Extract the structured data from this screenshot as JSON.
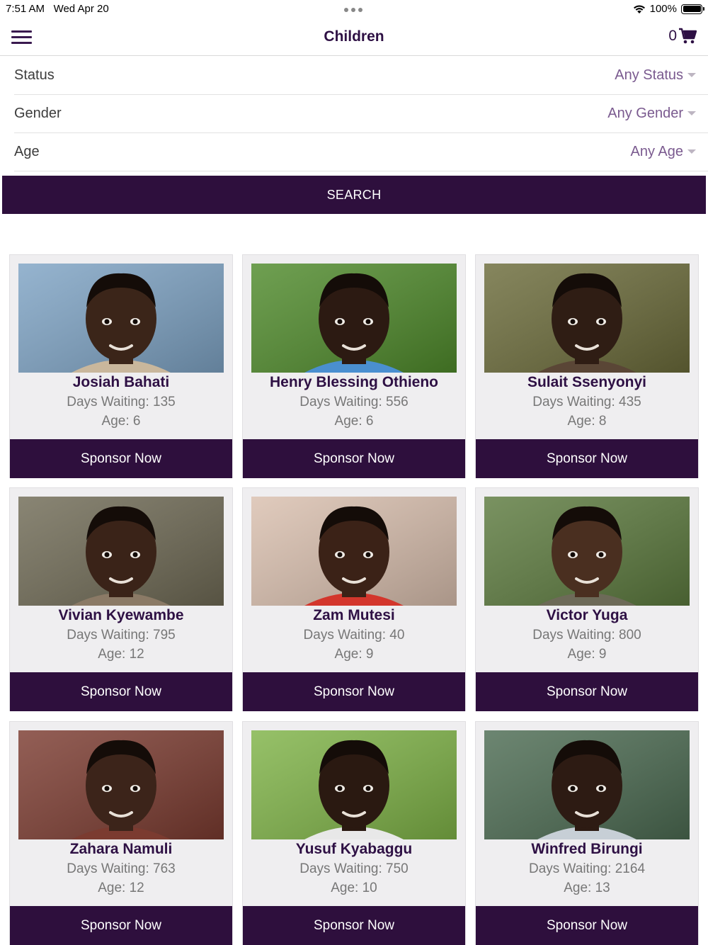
{
  "status_bar": {
    "time": "7:51 AM",
    "date": "Wed Apr 20",
    "battery": "100%"
  },
  "nav": {
    "title": "Children",
    "cart_count": "0"
  },
  "filters": [
    {
      "label": "Status",
      "value": "Any Status"
    },
    {
      "label": "Gender",
      "value": "Any Gender"
    },
    {
      "label": "Age",
      "value": "Any Age"
    }
  ],
  "search_label": "SEARCH",
  "sponsor_label": "Sponsor Now",
  "children": [
    {
      "name": "Josiah Bahati",
      "days": "Days Waiting: 135",
      "age": "Age: 6",
      "bg": "#7ea3c4",
      "skin": "#3b2519",
      "shirt": "#c9b79c"
    },
    {
      "name": "Henry Blessing Othieno",
      "days": "Days Waiting: 556",
      "age": "Age: 6",
      "bg": "#4f8a2b",
      "skin": "#2c1a12",
      "shirt": "#4a8fd0"
    },
    {
      "name": "Sulait Ssenyonyi",
      "days": "Days Waiting: 435",
      "age": "Age: 8",
      "bg": "#6b6b3a",
      "skin": "#2f1d14",
      "shirt": "#5a4636"
    },
    {
      "name": "Vivian Kyewambe",
      "days": "Days Waiting: 795",
      "age": "Age: 12",
      "bg": "#6f6a55",
      "skin": "#3a2318",
      "shirt": "#8b7a66"
    },
    {
      "name": "Zam Mutesi",
      "days": "Days Waiting: 40",
      "age": "Age: 9",
      "bg": "#d9bfae",
      "skin": "#3b2217",
      "shirt": "#d3362c"
    },
    {
      "name": "Victor Yuga",
      "days": "Days Waiting: 800",
      "age": "Age: 9",
      "bg": "#5c7a3e",
      "skin": "#4a2f20",
      "shirt": "#6d6a58"
    },
    {
      "name": "Zahara Namuli",
      "days": "Days Waiting: 763",
      "age": "Age: 12",
      "bg": "#7b3b30",
      "skin": "#3c241a",
      "shirt": "#7b3b30"
    },
    {
      "name": "Yusuf Kyabaggu",
      "days": "Days Waiting: 750",
      "age": "Age: 10",
      "bg": "#7fb347",
      "skin": "#2a1911",
      "shirt": "#e8e8e8"
    },
    {
      "name": "Winfred Birungi",
      "days": "Days Waiting: 2164",
      "age": "Age: 13",
      "bg": "#4c6b52",
      "skin": "#2d1b13",
      "shirt": "#c7cfd6"
    }
  ]
}
